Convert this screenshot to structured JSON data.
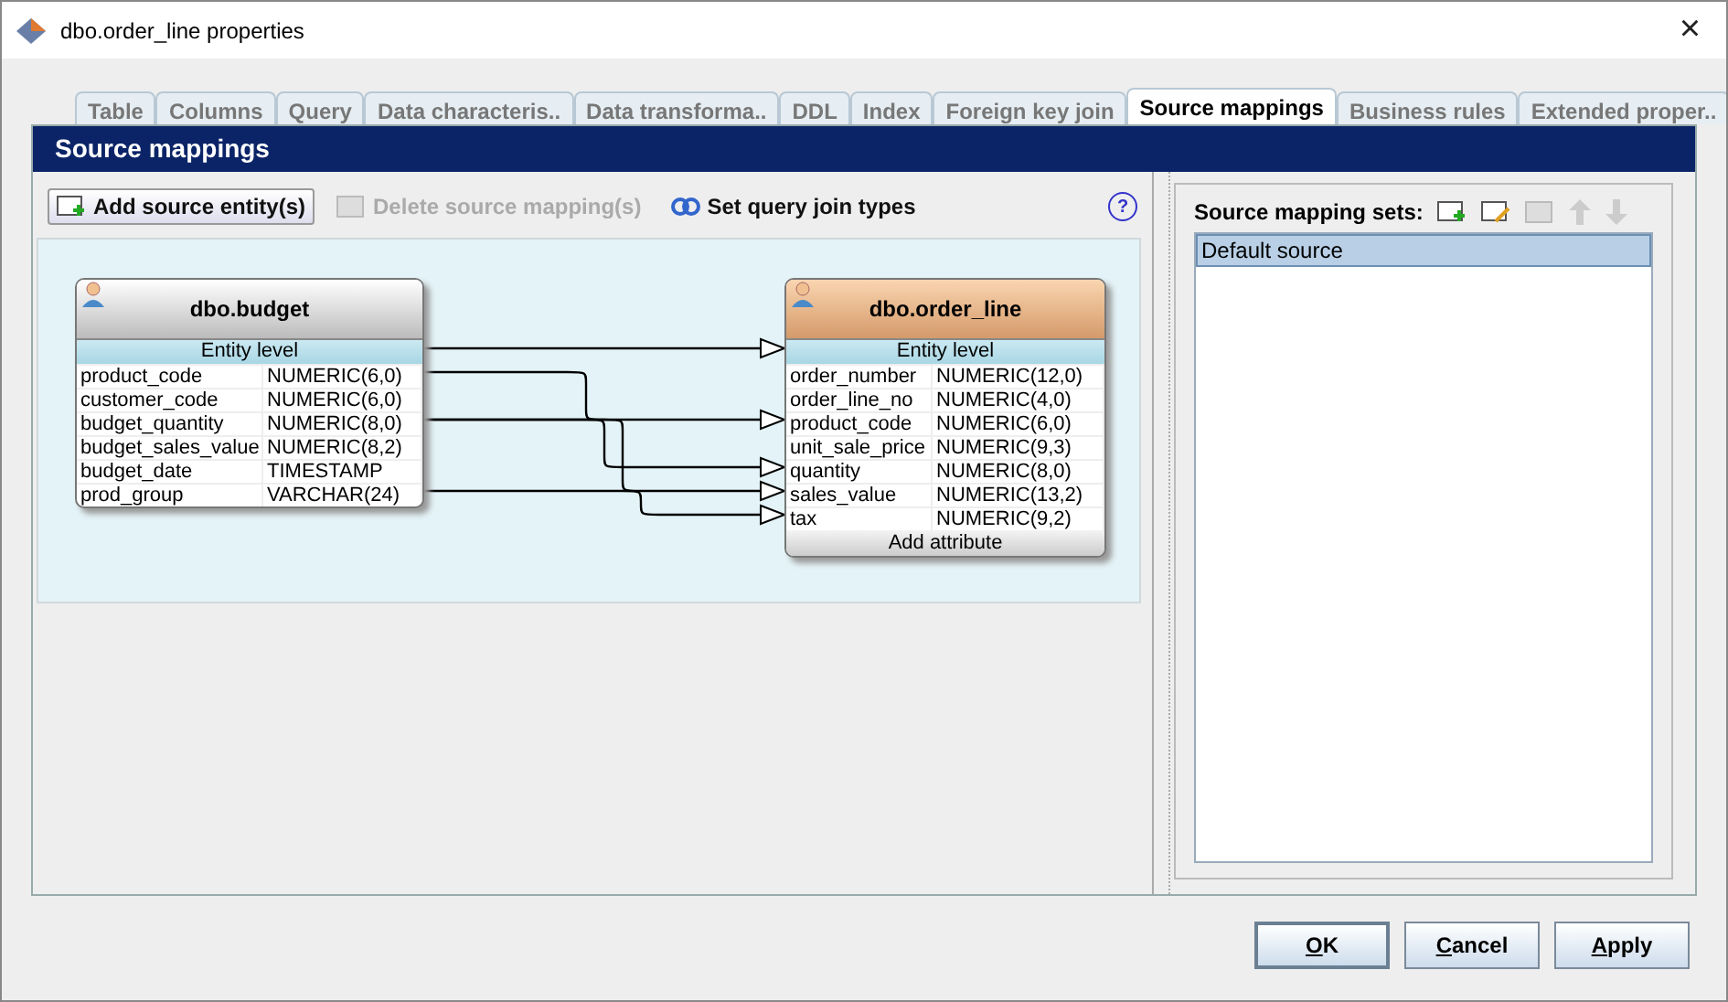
{
  "window": {
    "title": "dbo.order_line properties",
    "close": "×"
  },
  "tabs": [
    {
      "label": "Table",
      "selected": false
    },
    {
      "label": "Columns",
      "selected": false
    },
    {
      "label": "Query",
      "selected": false
    },
    {
      "label": "Data characteris..",
      "selected": false
    },
    {
      "label": "Data transforma..",
      "selected": false
    },
    {
      "label": "DDL",
      "selected": false
    },
    {
      "label": "Index",
      "selected": false
    },
    {
      "label": "Foreign key join",
      "selected": false
    },
    {
      "label": "Source mappings",
      "selected": true
    },
    {
      "label": "Business rules",
      "selected": false
    },
    {
      "label": "Extended proper..",
      "selected": false
    }
  ],
  "section_title": "Source mappings",
  "toolbar": [
    {
      "label": "Add source entity(s)",
      "kind": "add",
      "disabled": false
    },
    {
      "label": "Delete source mapping(s)",
      "kind": "delete",
      "disabled": true
    },
    {
      "label": "Set query join types",
      "kind": "join",
      "disabled": false
    }
  ],
  "help": "?",
  "entities": [
    {
      "name": "dbo.budget",
      "kind": "source",
      "level_label": "Entity level",
      "level_mapped": true,
      "attributes": [
        {
          "name": "product_code",
          "type": "NUMERIC(6,0)",
          "mapped": true
        },
        {
          "name": "customer_code",
          "type": "NUMERIC(6,0)"
        },
        {
          "name": "budget_quantity",
          "type": "NUMERIC(8,0)",
          "mapped": true
        },
        {
          "name": "budget_sales_value",
          "type": "NUMERIC(8,2)"
        },
        {
          "name": "budget_date",
          "type": "TIMESTAMP"
        },
        {
          "name": "prod_group",
          "type": "VARCHAR(24)",
          "mapped": true
        }
      ]
    },
    {
      "name": "dbo.order_line",
      "kind": "target",
      "level_label": "Entity level",
      "level_mapped": true,
      "footer": "Add attribute",
      "attributes": [
        {
          "name": "order_number",
          "type": "NUMERIC(12,0)"
        },
        {
          "name": "order_line_no",
          "type": "NUMERIC(4,0)"
        },
        {
          "name": "product_code",
          "type": "NUMERIC(6,0)",
          "mapped": true
        },
        {
          "name": "unit_sale_price",
          "type": "NUMERIC(9,3)"
        },
        {
          "name": "quantity",
          "type": "NUMERIC(8,0)",
          "mapped": true
        },
        {
          "name": "sales_value",
          "type": "NUMERIC(13,2)",
          "mapped": true
        },
        {
          "name": "tax",
          "type": "NUMERIC(9,2)",
          "mapped": true
        }
      ]
    }
  ],
  "mapping_sets": {
    "label": "Source mapping sets:",
    "items": [
      {
        "name": "Default source",
        "selected": true
      }
    ]
  },
  "buttons": [
    {
      "mnemonic": "O",
      "rest": "K",
      "default": true
    },
    {
      "mnemonic": "C",
      "rest": "ancel",
      "default": false
    },
    {
      "mnemonic": "A",
      "rest": "pply",
      "default": false
    }
  ]
}
